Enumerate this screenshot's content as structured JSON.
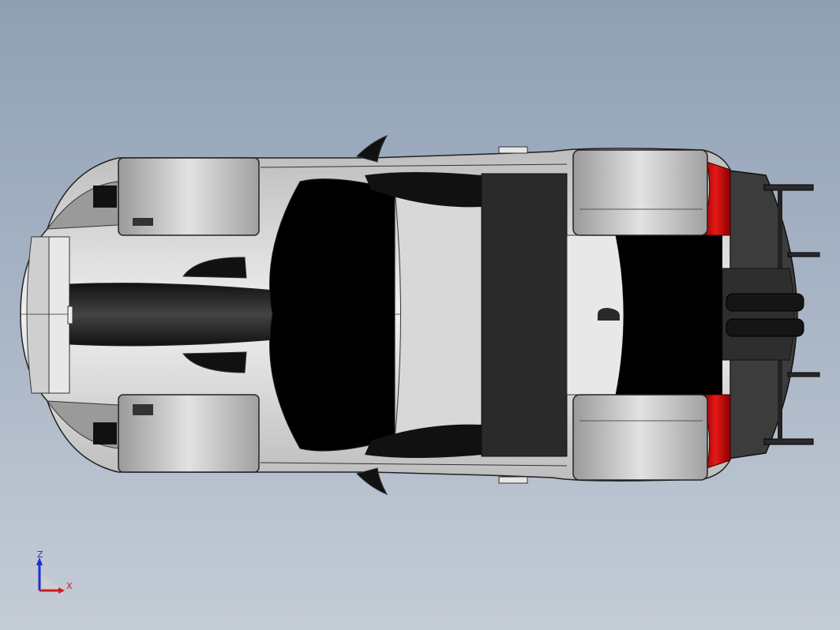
{
  "viewport": {
    "background_top": "#8fa0b4",
    "background_bottom": "#c4ccd6"
  },
  "model": {
    "name": "race-car-top-view",
    "body_color": "#d8d8d8",
    "glass_color": "#000000",
    "wheel_color": "#c8c8c8",
    "accent_color": "#e01010",
    "wing_color": "#3a3a3a"
  },
  "triad": {
    "z_label": "Z",
    "x_label": "X",
    "z_color": "#1a2fd0",
    "x_color": "#d01a1a"
  }
}
